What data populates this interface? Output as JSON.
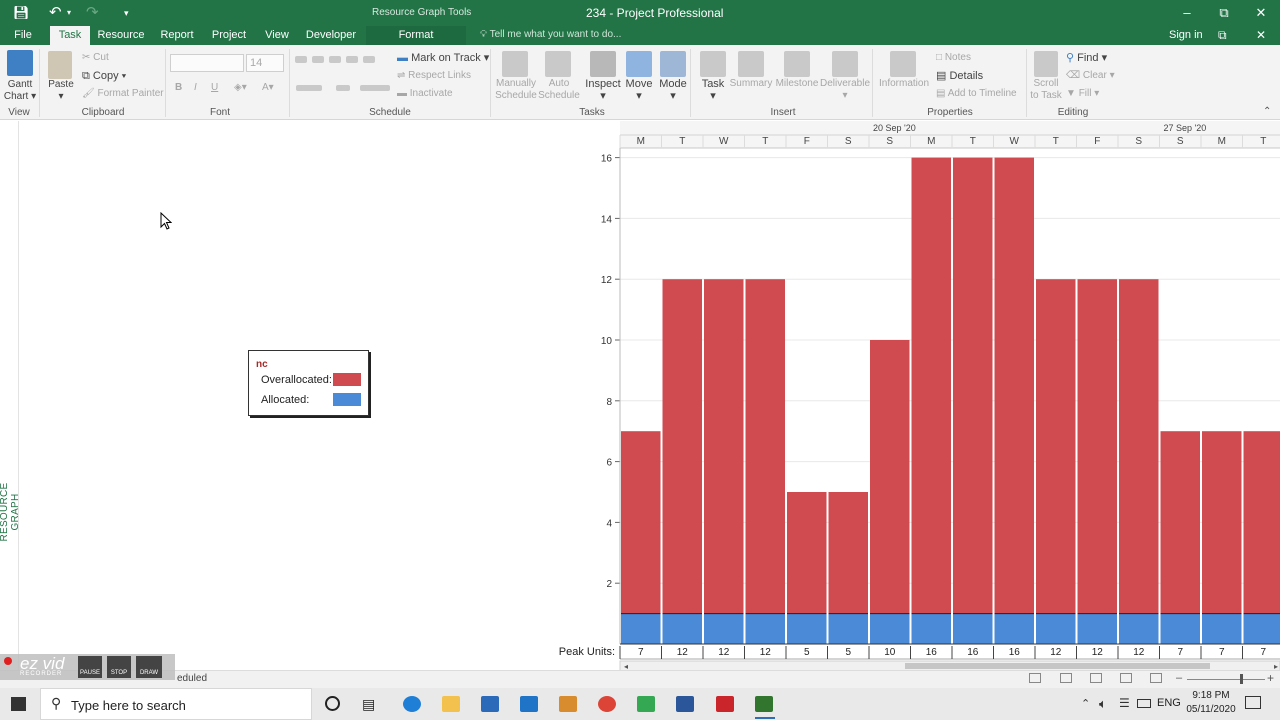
{
  "titlebar": {
    "context_label": "Resource Graph Tools",
    "document_title": "234 - Project Professional"
  },
  "tabs": [
    "File",
    "Task",
    "Resource",
    "Report",
    "Project",
    "View",
    "Developer",
    "Format"
  ],
  "tell_me": "Tell me what you want to do...",
  "sign_in": "Sign in",
  "ribbon": {
    "view": {
      "gantt_label_1": "Gantt",
      "gantt_label_2": "Chart",
      "group": "View"
    },
    "clipboard": {
      "paste": "Paste",
      "cut": "Cut",
      "copy": "Copy",
      "format_painter": "Format Painter",
      "group": "Clipboard"
    },
    "font": {
      "size": "14",
      "group": "Font"
    },
    "schedule": {
      "mark_on_track": "Mark on Track",
      "respect_links": "Respect Links",
      "inactivate": "Inactivate",
      "group": "Schedule"
    },
    "tasks": {
      "manually_1": "Manually",
      "manually_2": "Schedule",
      "auto_1": "Auto",
      "auto_2": "Schedule",
      "inspect": "Inspect",
      "move": "Move",
      "mode": "Mode",
      "group": "Tasks"
    },
    "insert": {
      "task": "Task",
      "summary": "Summary",
      "milestone": "Milestone",
      "deliverable": "Deliverable",
      "group": "Insert"
    },
    "properties": {
      "information": "Information",
      "notes": "Notes",
      "details": "Details",
      "add_to_timeline": "Add to Timeline",
      "group": "Properties"
    },
    "editing": {
      "scroll_1": "Scroll",
      "scroll_2": "to Task",
      "find": "Find",
      "clear": "Clear",
      "fill": "Fill",
      "group": "Editing"
    }
  },
  "side_label": "RESOURCE GRAPH",
  "legend": {
    "title": "nc",
    "overallocated": "Overallocated:",
    "allocated": "Allocated:"
  },
  "colors": {
    "overallocated": "#d04b50",
    "allocated": "#4a8ad6",
    "brand": "#227447"
  },
  "chart_data": {
    "type": "bar",
    "week_labels": [
      "20 Sep '20",
      "27 Sep '20"
    ],
    "day_labels": [
      "M",
      "T",
      "W",
      "T",
      "F",
      "S",
      "S",
      "M",
      "T",
      "W",
      "T",
      "F",
      "S",
      "S",
      "M",
      "T"
    ],
    "ylim": [
      0,
      17
    ],
    "yticks": [
      2,
      4,
      6,
      8,
      10,
      12,
      14,
      16
    ],
    "series": [
      {
        "name": "Overallocated",
        "values": [
          7,
          12,
          12,
          12,
          5,
          5,
          10,
          16,
          16,
          16,
          12,
          12,
          12,
          7,
          7,
          7
        ]
      },
      {
        "name": "Allocated",
        "values": [
          1,
          1,
          1,
          1,
          1,
          1,
          1,
          1,
          1,
          1,
          1,
          1,
          1,
          1,
          1,
          1
        ]
      }
    ],
    "peak_units_label": "Peak Units:",
    "peak_units": [
      "7",
      "12",
      "12",
      "12",
      "5",
      "5",
      "10",
      "16",
      "16",
      "16",
      "12",
      "12",
      "12",
      "7",
      "7",
      "7"
    ]
  },
  "status": {
    "text": "eduled"
  },
  "ezvid": {
    "logo": "ez vid",
    "sub": "RECORDER",
    "pause": "PAUSE",
    "stop": "STOP",
    "draw": "DRAW"
  },
  "taskbar": {
    "search_placeholder": "Type here to search",
    "language": "ENG",
    "time": "9:18 PM",
    "date": "05/11/2020"
  }
}
